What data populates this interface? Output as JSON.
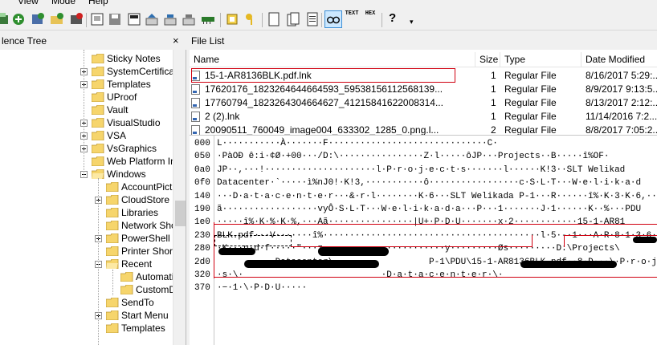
{
  "menu": {
    "items": [
      "View",
      "Mode",
      "Help"
    ]
  },
  "toolbar": {
    "text_button": "TEXT",
    "hex_button": "HEX",
    "help_glyph": "?"
  },
  "panes": {
    "tree_title": "lence Tree",
    "tree_close": "×",
    "filelist_title": "File List"
  },
  "tree": {
    "items": [
      {
        "label": "Sticky Notes",
        "expander": "none"
      },
      {
        "label": "SystemCertificate",
        "expander": "closed"
      },
      {
        "label": "Templates",
        "expander": "closed"
      },
      {
        "label": "UProof",
        "expander": "none"
      },
      {
        "label": "Vault",
        "expander": "none"
      },
      {
        "label": "VisualStudio",
        "expander": "closed"
      },
      {
        "label": "VSA",
        "expander": "closed"
      },
      {
        "label": "VsGraphics",
        "expander": "closed"
      },
      {
        "label": "Web Platform Ins",
        "expander": "none"
      },
      {
        "label": "Windows",
        "expander": "open"
      },
      {
        "label": "AccountPictu",
        "expander": "none"
      },
      {
        "label": "CloudStore",
        "expander": "closed"
      },
      {
        "label": "Libraries",
        "expander": "none"
      },
      {
        "label": "Network Sho",
        "expander": "none"
      },
      {
        "label": "PowerShell",
        "expander": "closed"
      },
      {
        "label": "Printer Shorte",
        "expander": "none"
      },
      {
        "label": "Recent",
        "expander": "open"
      },
      {
        "label": "Automati",
        "expander": "none"
      },
      {
        "label": "CustomD",
        "expander": "none"
      },
      {
        "label": "SendTo",
        "expander": "none"
      },
      {
        "label": "Start Menu",
        "expander": "closed"
      },
      {
        "label": "Templates",
        "expander": "none"
      }
    ]
  },
  "filelist": {
    "columns": [
      "Name",
      "Size",
      "Type",
      "Date Modified"
    ],
    "rows": [
      {
        "name": "15-1-AR8136BLK.pdf.lnk",
        "size": "1",
        "type": "Regular File",
        "date": "8/16/2017 5:29:..."
      },
      {
        "name": "17620176_1823264644664593_59538156112568139...",
        "size": "1",
        "type": "Regular File",
        "date": "8/9/2017 9:13:5..."
      },
      {
        "name": "17760794_1823264304664627_41215841622008314...",
        "size": "1",
        "type": "Regular File",
        "date": "8/13/2017 2:12:..."
      },
      {
        "name": "2 (2).lnk",
        "size": "1",
        "type": "Regular File",
        "date": "11/14/2016 7:2..."
      },
      {
        "name": "20090511_760049_image004_633302_1285_0.png.l...",
        "size": "2",
        "type": "Regular File",
        "date": "8/8/2017 7:05:2..."
      }
    ]
  },
  "hex": {
    "rows": [
      {
        "offset": "000",
        "text": "L···········À·······F······························C·"
      },
      {
        "offset": "050",
        "text": "·PàOÐ ê:i·¢Ø·+00···/D:\\················Z·l·····ôJP···Projects··B·····î%OF·"
      },
      {
        "offset": "0a0",
        "text": "JP··,···!·····················l·P·r·o·j·e·c·t·s·······l······K!3··SLT Welikad"
      },
      {
        "offset": "0f0",
        "text": "Datacenter·`·····ì%nJ0!·K!3,···········ô·················c·S·L·T···W·e·l·i·k·a·d"
      },
      {
        "offset": "140",
        "text": "···D·a·t·a·c·e·n·t·e·r···&·r·l········K·6···SLT Welikada P-1···R······î%·K·3·K·6,··"
      },
      {
        "offset": "190",
        "text": "ã··················vyÔ·S·L·T···W·e·l·i·k·a·d·a···P···1·······J·1······K··%···PDU"
      },
      {
        "offset": "1e0",
        "text": "·····î%·K·%·K·%,···Aã················|U+·P·D·U·······x·2············15-1-AR81"
      },
      {
        "offset": "230",
        "text": "BLK.pdf···V·······î%·········································l·5·-·1···A·R·8·1·3·6·B"
      },
      {
        "offset": "280",
        "text": "·K···p·d·f·····\"···z·······················y·········Øs·········D:\\Projects\\"
      },
      {
        "offset": "2d0",
        "text": "           Datacenter\\                  P-1\\PDU\\15-1-AR8136BLK.pdf··8·D···\\·P·r·o·j·e·c·"
      },
      {
        "offset": "320",
        "text": "·s·\\·                          ·D·a·t·a·c·e·n·t·e·r·\\·                    "
      },
      {
        "offset": "370",
        "text": "·−·1·\\·P·D·U·····"
      }
    ]
  },
  "colors": {
    "highlight_red": "#d00010",
    "folder_yellow": "#f6d56c",
    "selection_blue": "#cce8ff"
  }
}
